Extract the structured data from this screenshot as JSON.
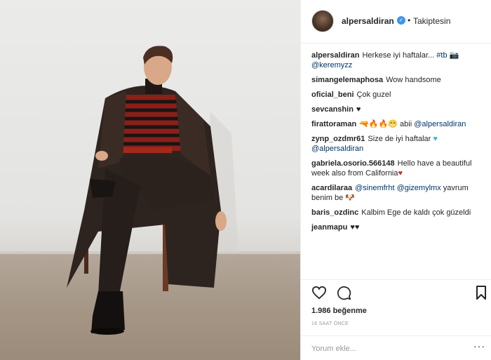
{
  "post": {
    "image_description_name": "photo",
    "header": {
      "username": "alpersaldiran",
      "verified_glyph": "✓",
      "separator": "•",
      "follow_label": "Takiptesin"
    },
    "comments": [
      {
        "user": "alpersaldiran",
        "text": "Herkese iyi haftalar... ",
        "mention": "#tb",
        "tail": " 📷 ",
        "mention2": "@keremyzz"
      },
      {
        "user": "simangelemaphosa",
        "text": "Wow handsome"
      },
      {
        "user": "oficial_beni",
        "text": "Çok guzel"
      },
      {
        "user": "sevcanshin",
        "text": "",
        "heart": "♥"
      },
      {
        "user": "firattoraman",
        "text": "🔫🔥🔥😁 abii ",
        "mention": "@alpersaldiran"
      },
      {
        "user": "zynp_ozdmr61",
        "text": "Size de iyi haftalar ",
        "blueheart": "♥",
        "mention": "@alpersaldiran"
      },
      {
        "user": "gabriela.osorio.566148",
        "text": "Hello have a beautiful week also from California",
        "heart": "♥"
      },
      {
        "user": "acardilaraa",
        "mention": "@sinemfrht",
        "mention2": "@gizemylmx",
        "text": " yavrum benim be 🐶"
      },
      {
        "user": "baris_ozdinc",
        "text": "Kalbim Ege de kaldı çok güzeldi"
      },
      {
        "user": "jeanmapu",
        "text": "",
        "heart": "♥♥"
      }
    ],
    "likes": "1.986 beğenme",
    "time": "16 SAAT ÖNCE",
    "comment_placeholder": "Yorum ekle...",
    "more_glyph": "···"
  },
  "icons": [
    "heart-icon",
    "comment-icon",
    "bookmark-icon",
    "verified-icon"
  ]
}
